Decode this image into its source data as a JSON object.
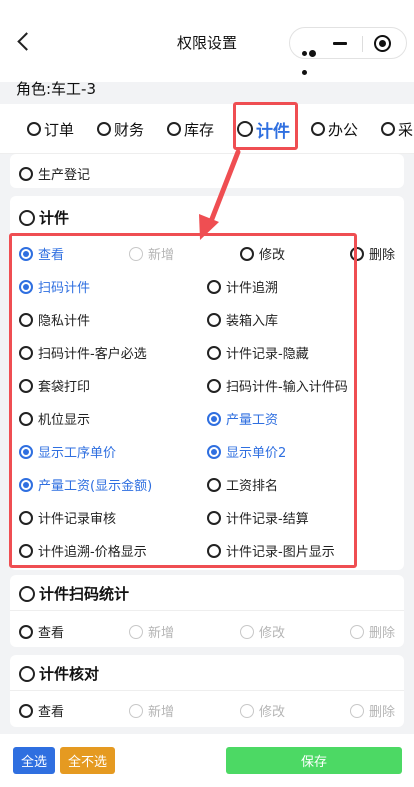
{
  "nav": {
    "title": "权限设置"
  },
  "role_label": "角色:车工-3",
  "tabs": [
    {
      "label": "订单",
      "active": false
    },
    {
      "label": "财务",
      "active": false
    },
    {
      "label": "库存",
      "active": false
    },
    {
      "label": "计件",
      "active": true
    },
    {
      "label": "办公",
      "active": false
    },
    {
      "label": "采",
      "active": false
    }
  ],
  "section_prod": {
    "item": "生产登记"
  },
  "section_jijian": {
    "title": "计件",
    "ops": [
      "查看",
      "新增",
      "修改",
      "删除"
    ],
    "items": [
      [
        "扫码计件",
        "计件追溯"
      ],
      [
        "隐私计件",
        "装箱入库"
      ],
      [
        "扫码计件-客户必选",
        "计件记录-隐藏"
      ],
      [
        "套袋打印",
        "扫码计件-输入计件码"
      ],
      [
        "机位显示",
        "产量工资"
      ],
      [
        "显示工序单价",
        "显示单价2"
      ],
      [
        "产量工资(显示金额)",
        "工资排名"
      ],
      [
        "计件记录审核",
        "计件记录-结算"
      ],
      [
        "计件追溯-价格显示",
        "计件记录-图片显示"
      ]
    ]
  },
  "section_scan": {
    "title": "计件扫码统计",
    "ops": [
      "查看",
      "新增",
      "修改",
      "删除"
    ]
  },
  "section_check": {
    "title": "计件核对",
    "ops": [
      "查看",
      "新增",
      "修改",
      "删除"
    ]
  },
  "buttons": {
    "select_all": "全选",
    "select_none": "全不选",
    "save": "保存"
  },
  "colors": {
    "accent": "#2f6fe0",
    "annotation": "#ef4e52",
    "save": "#4cd964",
    "none": "#e59a21"
  }
}
